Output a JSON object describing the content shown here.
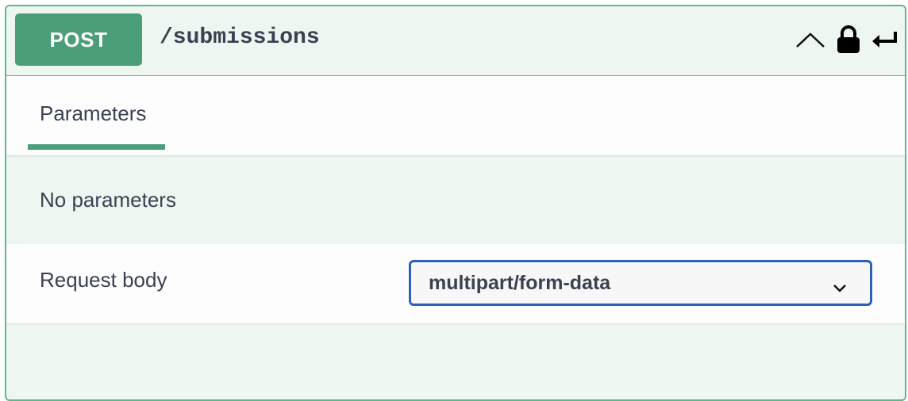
{
  "operation": {
    "method": "POST",
    "path": "/submissions",
    "icons": {
      "collapse": "chevron-up-icon",
      "lock": "lock-icon",
      "back": "return-arrow-icon"
    }
  },
  "tabs": {
    "parameters_label": "Parameters"
  },
  "parameters": {
    "empty_text": "No parameters"
  },
  "request_body": {
    "label": "Request body",
    "content_type": "multipart/form-data"
  },
  "colors": {
    "accent": "#4a9e78",
    "border": "#5fb88b",
    "select_border": "#2f5fb8",
    "text": "#3b4151"
  }
}
